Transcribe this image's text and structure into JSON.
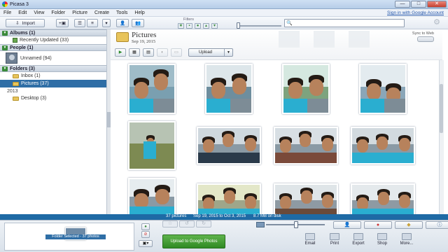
{
  "window": {
    "title": "Picasa 3",
    "min": "—",
    "max": "□",
    "close": "✕"
  },
  "menu": {
    "items": [
      "File",
      "Edit",
      "View",
      "Folder",
      "Picture",
      "Create",
      "Tools",
      "Help"
    ],
    "signin": "Sign in with Google Account"
  },
  "toolbar": {
    "import_label": "Import",
    "filters_label": "Filters",
    "search_placeholder": "",
    "help_icon": "help-icon"
  },
  "sidebar": {
    "albums_header": "Albums (1)",
    "albums": [
      {
        "label": "Recently Updated (33)"
      }
    ],
    "people_header": "People (1)",
    "people": [
      {
        "label": "Unnamed (94)"
      }
    ],
    "folders_header": "Folders (3)",
    "folders": [
      {
        "label": "Inbox (1)"
      },
      {
        "label": "Pictures (37)"
      }
    ],
    "year": "2013",
    "older_folders": [
      {
        "label": "Desktop (3)"
      }
    ]
  },
  "folder_view": {
    "title": "Pictures",
    "date": "Sep 19, 2015",
    "sync_label": "Sync to Web",
    "upload_label": "Upload"
  },
  "status": {
    "count": "37 pictures",
    "range": "Sep 19, 2015 to Oct 3, 2015",
    "disk": "8.7 MB on disk"
  },
  "tray": {
    "caption": "Folder Selected - 37 photos",
    "upload_google": "Upload to Google Photos",
    "actions": [
      "Email",
      "Print",
      "Export",
      "Shop",
      "More..."
    ]
  },
  "colors": {
    "selection": "#2f6ea6",
    "status_bar": "#1e6aa5",
    "upload_green": "#3f9a31"
  }
}
